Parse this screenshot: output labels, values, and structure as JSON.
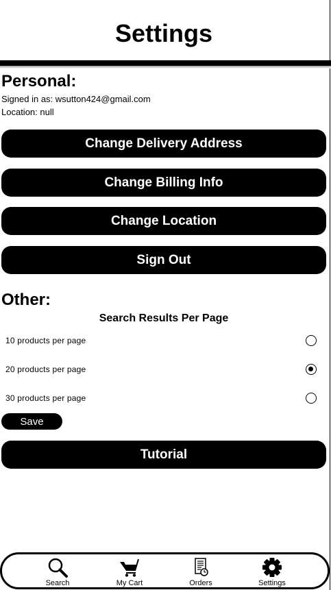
{
  "header": {
    "title": "Settings"
  },
  "personal": {
    "heading": "Personal:",
    "signed_in": "Signed in as: wsutton424@gmail.com",
    "location": "Location: null",
    "buttons": [
      {
        "label": "Change Delivery Address"
      },
      {
        "label": "Change Billing Info"
      },
      {
        "label": "Change Location"
      },
      {
        "label": "Sign Out"
      }
    ]
  },
  "other": {
    "heading": "Other:",
    "results_title": "Search Results Per Page",
    "options": [
      {
        "label": "10 products per page",
        "selected": false
      },
      {
        "label": "20 products per page",
        "selected": true
      },
      {
        "label": "30 products per page",
        "selected": false
      }
    ],
    "save_label": "Save",
    "tutorial_label": "Tutorial"
  },
  "nav": {
    "items": [
      {
        "label": "Search",
        "icon": "search-icon"
      },
      {
        "label": "My Cart",
        "icon": "cart-icon"
      },
      {
        "label": "Orders",
        "icon": "orders-icon"
      },
      {
        "label": "Settings",
        "icon": "gear-icon"
      }
    ]
  }
}
